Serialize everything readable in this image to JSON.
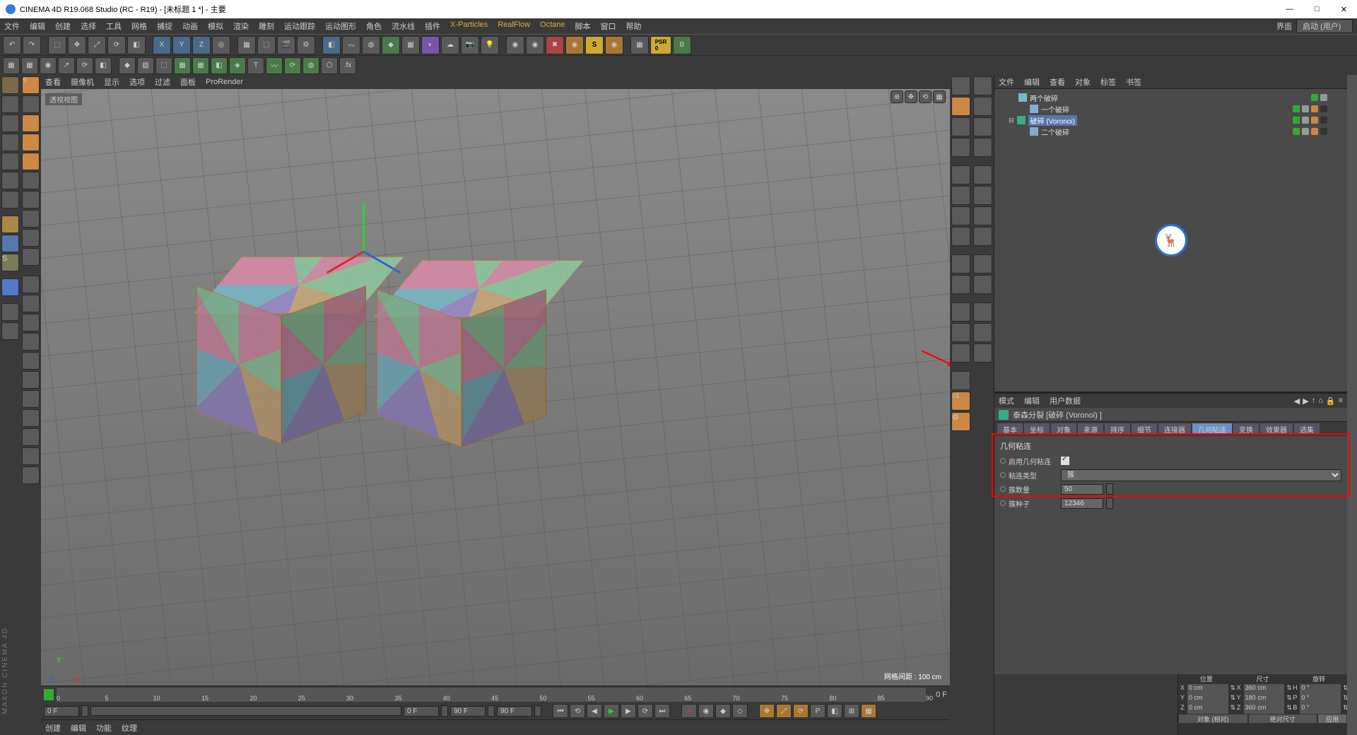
{
  "title": "CINEMA 4D R19.068 Studio (RC - R19) - [未标题 1 *] - 主要",
  "menu": [
    "文件",
    "编辑",
    "创建",
    "选择",
    "工具",
    "网格",
    "捕捉",
    "动画",
    "模拟",
    "渲染",
    "雕刻",
    "运动跟踪",
    "运动图形",
    "角色",
    "流水线",
    "插件",
    "X-Particles",
    "RealFlow",
    "Octane",
    "脚本",
    "窗口",
    "帮助"
  ],
  "menu_hl": [
    "X-Particles",
    "RealFlow",
    "Octane"
  ],
  "layout_label": "界面",
  "layout_value": "启动 (用户)",
  "view_menu": [
    "查看",
    "摄像机",
    "显示",
    "选项",
    "过滤",
    "面板",
    "ProRender"
  ],
  "vp_label": "透视视图",
  "vp_info": "网格间距 : 100 cm",
  "axes": {
    "x": "X",
    "y": "Y",
    "z": "Z"
  },
  "obj_menu": [
    "文件",
    "编辑",
    "查看",
    "对象",
    "标签",
    "书签"
  ],
  "tree": [
    {
      "depth": 0,
      "name": "两个破碎",
      "icon": "#7ab8c9",
      "sel": false
    },
    {
      "depth": 1,
      "name": "一个破碎",
      "icon": "#88aacc",
      "sel": false
    },
    {
      "depth": 0,
      "name": "破碎 (Voronoi)",
      "icon": "#3aaa8a",
      "sel": true,
      "expand": true
    },
    {
      "depth": 1,
      "name": "二个破碎",
      "icon": "#88aacc",
      "sel": false
    }
  ],
  "attr_menu_left": [
    "模式",
    "编辑",
    "用户数据"
  ],
  "attr_title": "泰森分裂 [破碎 (Voronoi) ]",
  "attr_tabs": [
    "基本",
    "坐标",
    "对象",
    "来源",
    "排序",
    "细节",
    "连接器",
    "几何粘连",
    "变换",
    "效果器",
    "选集"
  ],
  "attr_tab_active": "几何粘连",
  "attr_section": "几何粘连",
  "attr_params": [
    {
      "label": "启用几何粘连",
      "type": "check",
      "value": true
    },
    {
      "label": "粘连类型",
      "type": "select",
      "value": "簇"
    },
    {
      "label": "簇数量",
      "type": "num",
      "value": "50"
    },
    {
      "label": "簇种子",
      "type": "num",
      "value": "12346"
    }
  ],
  "timeline": {
    "start": 0,
    "end": 90,
    "ticks": [
      0,
      5,
      10,
      15,
      20,
      25,
      30,
      35,
      40,
      45,
      50,
      55,
      60,
      65,
      70,
      75,
      80,
      85,
      90
    ],
    "frame_end": "0 F"
  },
  "playbar": {
    "cur": "0 F",
    "f2": "0 F",
    "f3": "90 F",
    "f4": "90 F"
  },
  "status_menu": [
    "创建",
    "编辑",
    "功能",
    "纹理"
  ],
  "coords": {
    "hdr": [
      "位置",
      "尺寸",
      "旋转"
    ],
    "rows": [
      {
        "a": "X",
        "p": "0 cm",
        "s": "360 cm",
        "rL": "H",
        "r": "0 °"
      },
      {
        "a": "Y",
        "p": "0 cm",
        "s": "180 cm",
        "rL": "P",
        "r": "0 °"
      },
      {
        "a": "Z",
        "p": "0 cm",
        "s": "360 cm",
        "rL": "B",
        "r": "0 °"
      }
    ],
    "sel1": "对象 (相对)",
    "sel2": "绝对尺寸",
    "btn": "应用"
  },
  "brand": "MAXON CINEMA 4D"
}
